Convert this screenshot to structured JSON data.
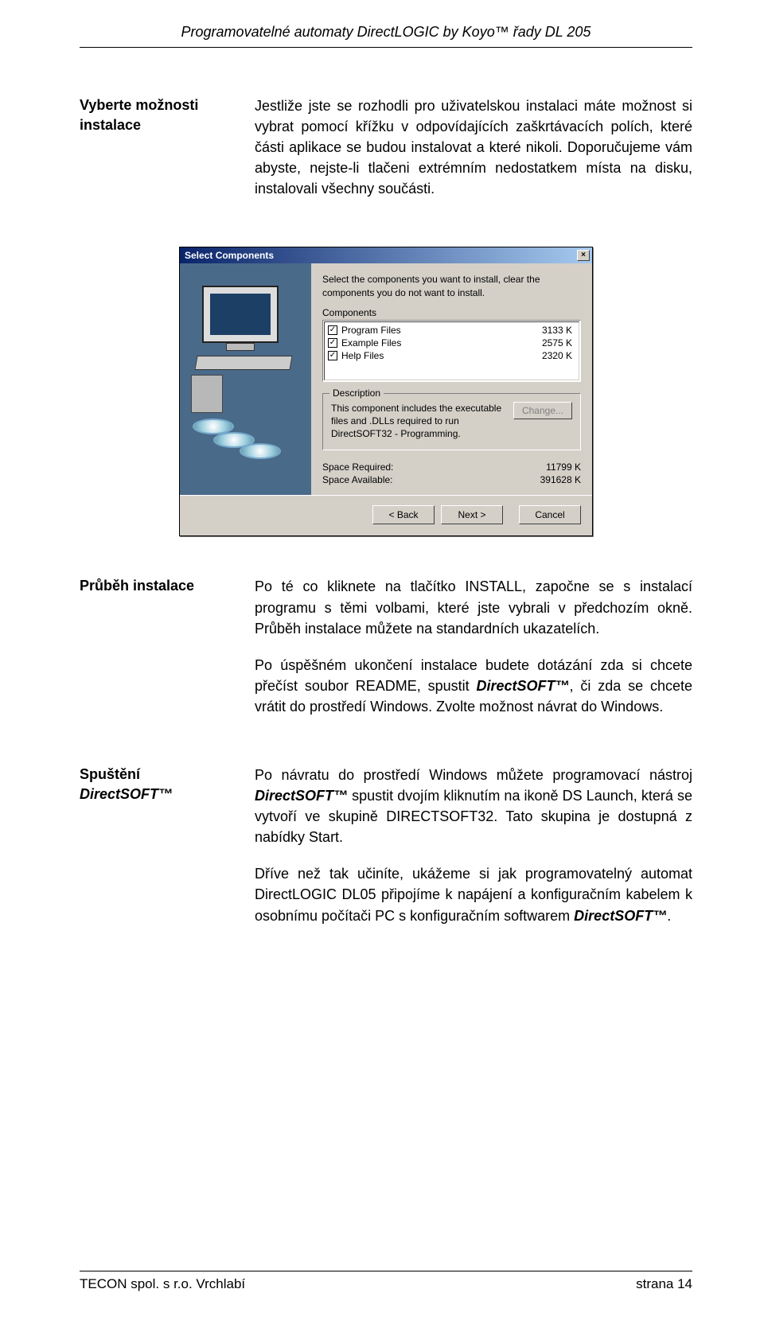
{
  "header": {
    "running_title": "Programovatelné automaty DirectLOGIC  by Koyo™ řady DL 205"
  },
  "sections": {
    "opts": {
      "label": "Vyberte možnosti instalace",
      "body": "Jestliže jste se rozhodli pro uživatelskou instalaci máte možnost si vybrat pomocí křížku v odpovídajících zaškrtávacích polích, které části aplikace se budou instalovat a které nikoli. Doporučujeme vám abyste, nejste-li tlačeni extrémním nedostatkem místa na disku, instalovali všechny součásti."
    },
    "progress": {
      "label": "Průběh instalace",
      "p1": "Po té co kliknete na tlačítko INSTALL, započne se s instalací programu s těmi volbami, které jste vybrali v předchozím okně. Průběh instalace můžete na standardních ukazatelích.",
      "p2_pre": "Po úspěšném ukončení instalace budete dotázání zda si chcete přečíst soubor README, spustit ",
      "p2_brand": "DirectSOFT™",
      "p2_post": ", či zda se chcete vrátit do prostředí Windows. Zvolte možnost návrat do Windows."
    },
    "launch": {
      "label_line1": "Spuštění",
      "label_brand": "DirectSOFT™",
      "p1_pre": "Po návratu do prostředí Windows můžete programovací nástroj ",
      "p1_brand": "DirectSOFT™",
      "p1_post": " spustit dvojím kliknutím na ikoně DS Launch, která se vytvoří ve skupině DIRECTSOFT32. Tato skupina je dostupná z nabídky Start.",
      "p2_pre": "Dříve než tak učiníte, ukážeme si jak programovatelný automat DirectLOGIC DL05 připojíme k napájení a konfiguračním kabelem k osobnímu počítači PC s konfiguračním softwarem ",
      "p2_brand": "DirectSOFT™",
      "p2_post": "."
    }
  },
  "dialog": {
    "title": "Select Components",
    "instruction": "Select the components you want to install, clear the components you do not want to install.",
    "components_label": "Components",
    "items": [
      {
        "label": "Program Files",
        "size": "3133 K"
      },
      {
        "label": "Example Files",
        "size": "2575 K"
      },
      {
        "label": "Help Files",
        "size": "2320 K"
      }
    ],
    "description_label": "Description",
    "description_text": "This component includes the executable files and .DLLs required to run DirectSOFT32 - Programming.",
    "change_btn": "Change...",
    "space_required_label": "Space Required:",
    "space_required_value": "11799 K",
    "space_available_label": "Space Available:",
    "space_available_value": "391628 K",
    "back_btn": "< Back",
    "next_btn": "Next >",
    "cancel_btn": "Cancel"
  },
  "footer": {
    "left": "TECON spol. s r.o.   Vrchlabí",
    "right": "strana 14"
  }
}
